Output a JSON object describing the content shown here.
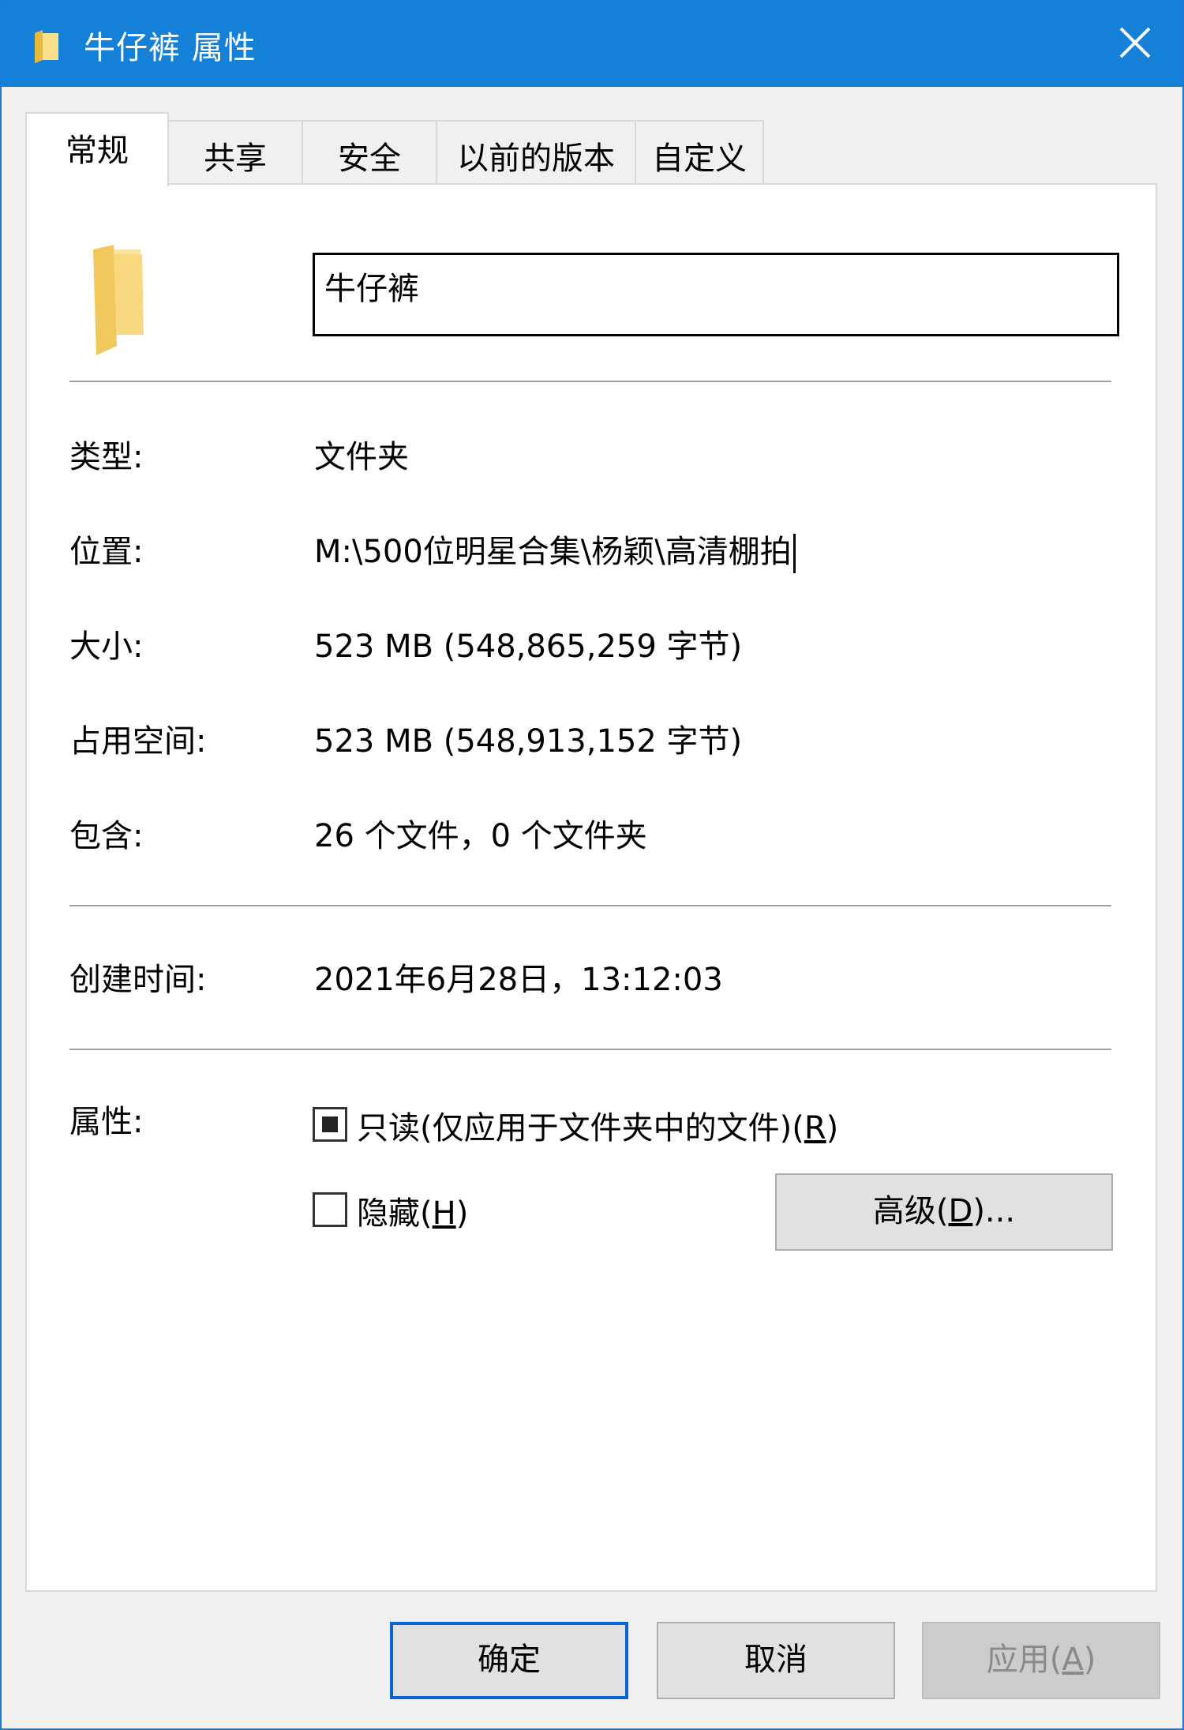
{
  "window": {
    "title": "牛仔裤 属性",
    "accent_color": "#1580d8",
    "title_icon": "folder-icon",
    "close_icon": "close-icon"
  },
  "tabs": [
    {
      "label": "常规",
      "active": true
    },
    {
      "label": "共享",
      "active": false
    },
    {
      "label": "安全",
      "active": false
    },
    {
      "label": "以前的版本",
      "active": false
    },
    {
      "label": "自定义",
      "active": false
    }
  ],
  "general": {
    "folder_icon": "folder-icon",
    "name_value": "牛仔裤",
    "properties": [
      {
        "label": "类型:",
        "value": "文件夹"
      },
      {
        "label": "位置:",
        "value": "M:\\500位明星合集\\杨颖\\高清棚拍"
      },
      {
        "label": "大小:",
        "value": "523 MB (548,865,259 字节)"
      },
      {
        "label": "占用空间:",
        "value": "523 MB (548,913,152 字节)"
      },
      {
        "label": "包含:",
        "value": "26 个文件，0 个文件夹"
      }
    ],
    "created": {
      "label": "创建时间:",
      "value": "2021年6月28日，13:12:03"
    },
    "attributes": {
      "label": "属性:",
      "readonly": {
        "text": "只读(仅应用于文件夹中的文件)(",
        "hotkey": "R",
        "suffix": ")",
        "state": "indeterminate"
      },
      "hidden": {
        "text": "隐藏(",
        "hotkey": "H",
        "suffix": ")",
        "checked": false
      },
      "advanced": {
        "text": "高级(",
        "hotkey": "D",
        "suffix": ")..."
      }
    }
  },
  "buttons": {
    "ok": "确定",
    "cancel": "取消",
    "apply": {
      "text": "应用(",
      "hotkey": "A",
      "suffix": ")",
      "disabled": true
    }
  }
}
